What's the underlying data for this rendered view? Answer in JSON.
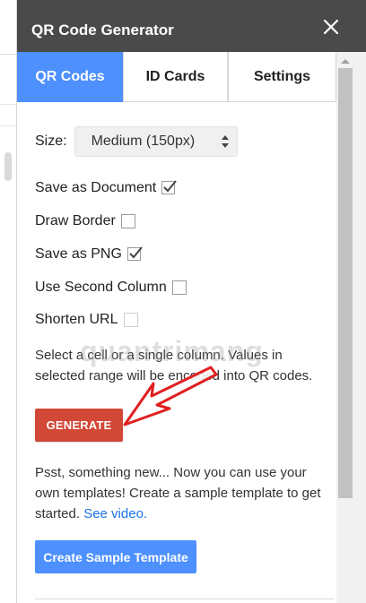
{
  "dialog": {
    "title": "QR Code Generator",
    "close_icon": "close-icon"
  },
  "tabs": [
    {
      "label": "QR Codes",
      "active": true
    },
    {
      "label": "ID Cards",
      "active": false
    },
    {
      "label": "Settings",
      "active": false
    }
  ],
  "size": {
    "label": "Size:",
    "selected": "Medium (150px)"
  },
  "options": [
    {
      "label": "Save as Document",
      "checked": true
    },
    {
      "label": "Draw Border",
      "checked": false
    },
    {
      "label": "Save as PNG",
      "checked": true
    },
    {
      "label": "Use Second Column",
      "checked": false
    },
    {
      "label": "Shorten URL",
      "checked": false
    }
  ],
  "instructions": "Select a cell or a single column. Values in selected range will be encoded into QR codes.",
  "generate_label": "GENERATE",
  "promo": {
    "text": "Psst, something new... Now you can use your own templates! Create a sample template to get started.",
    "link": "See video."
  },
  "template_button_label": "Create Sample Template",
  "watermark": "quantrimang",
  "colors": {
    "titlebar": "#4a4a4a",
    "accent": "#4d90fe",
    "generate": "#d14836",
    "annotation_arrow": "#e02020"
  }
}
